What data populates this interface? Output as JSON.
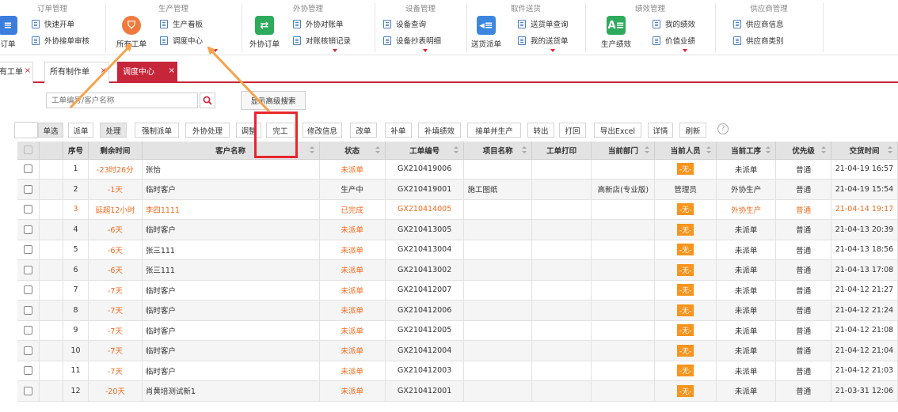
{
  "ribbon": {
    "groups": [
      {
        "title": "订单管理",
        "big_label": "订单",
        "items": [
          "快速开单",
          "外协接单审核"
        ]
      },
      {
        "title": "生产管理",
        "big_label": "所有工单",
        "items": [
          "生产看板",
          "调度中心"
        ]
      },
      {
        "title": "外协管理",
        "big_label": "外协订单",
        "items": [
          "外协对账单",
          "对账核销记录"
        ]
      },
      {
        "title": "设备管理",
        "items": [
          "设备查询",
          "设备抄表明细"
        ]
      },
      {
        "title": "取件送货",
        "big_label": "送货派单",
        "items": [
          "送货单查询",
          "我的送货单"
        ]
      },
      {
        "title": "绩效管理",
        "big_label": "生产绩效",
        "items": [
          "我的绩效",
          "价值业绩"
        ]
      },
      {
        "title": "供应商管理",
        "items": [
          "供应商信息",
          "供应商类别"
        ]
      }
    ]
  },
  "tabs": [
    {
      "label": "有工单"
    },
    {
      "label": "所有制作单"
    },
    {
      "label": "调度中心"
    }
  ],
  "tab_close": "×",
  "search": {
    "placeholder": "工单编号/客户名称",
    "adv_label": "显示高级搜索"
  },
  "toolbar": {
    "toggle_label": "单选",
    "buttons": [
      "派单",
      "处理",
      "强制派单",
      "外协处理",
      "调整",
      "完工",
      "修改信息",
      "改单",
      "补单",
      "补填绩效",
      "接单并生产",
      "转出",
      "打回",
      "导出Excel",
      "详情",
      "刷新"
    ],
    "help": "?"
  },
  "table": {
    "columns": [
      "序号",
      "剩余时间",
      "客户名称",
      "状态",
      "工单编号",
      "项目名称",
      "工单打印",
      "当前部门",
      "当前人员",
      "当前工序",
      "优先级",
      "交货时间"
    ],
    "rows": [
      {
        "no": "1",
        "remain": "-23时26分",
        "customer": "张怡",
        "status": "未派单",
        "code": "GX210419006",
        "project": "",
        "dept": "",
        "person": "-无-",
        "process": "未派单",
        "priority": "普通",
        "delivery": "21-04-19 16:57",
        "highlight": false
      },
      {
        "no": "2",
        "remain": "-1天",
        "customer": "临时客户",
        "status": "生产中",
        "code": "GX210419001",
        "project": "施工图纸",
        "dept": "高新店(专业版)",
        "person": "管理员",
        "process": "外协生产",
        "priority": "普通",
        "delivery": "21-04-19 15:54",
        "highlight": false
      },
      {
        "no": "3",
        "remain": "延超12小时",
        "customer": "李四1111",
        "status": "已完成",
        "code": "GX210414005",
        "project": "",
        "dept": "",
        "person": "-无-",
        "process": "外协生产",
        "priority": "普通",
        "delivery": "21-04-14 19:17",
        "highlight": true
      },
      {
        "no": "4",
        "remain": "-6天",
        "customer": "临时客户",
        "status": "未派单",
        "code": "GX210413005",
        "project": "",
        "dept": "",
        "person": "-无-",
        "process": "未派单",
        "priority": "普通",
        "delivery": "21-04-13 20:39",
        "highlight": false
      },
      {
        "no": "5",
        "remain": "-6天",
        "customer": "张三111",
        "status": "未派单",
        "code": "GX210413004",
        "project": "",
        "dept": "",
        "person": "-无-",
        "process": "未派单",
        "priority": "普通",
        "delivery": "21-04-13 18:56",
        "highlight": false
      },
      {
        "no": "6",
        "remain": "-6天",
        "customer": "张三111",
        "status": "未派单",
        "code": "GX210413002",
        "project": "",
        "dept": "",
        "person": "-无-",
        "process": "未派单",
        "priority": "普通",
        "delivery": "21-04-13 17:08",
        "highlight": false
      },
      {
        "no": "7",
        "remain": "-7天",
        "customer": "临时客户",
        "status": "未派单",
        "code": "GX210412007",
        "project": "",
        "dept": "",
        "person": "-无-",
        "process": "未派单",
        "priority": "普通",
        "delivery": "21-04-12 21:27",
        "highlight": false
      },
      {
        "no": "8",
        "remain": "-7天",
        "customer": "临时客户",
        "status": "未派单",
        "code": "GX210412006",
        "project": "",
        "dept": "",
        "person": "-无-",
        "process": "未派单",
        "priority": "普通",
        "delivery": "21-04-12 21:24",
        "highlight": false
      },
      {
        "no": "9",
        "remain": "-7天",
        "customer": "临时客户",
        "status": "未派单",
        "code": "GX210412005",
        "project": "",
        "dept": "",
        "person": "-无-",
        "process": "未派单",
        "priority": "普通",
        "delivery": "21-04-12 21:08",
        "highlight": false
      },
      {
        "no": "10",
        "remain": "-7天",
        "customer": "临时客户",
        "status": "未派单",
        "code": "GX210412004",
        "project": "",
        "dept": "",
        "person": "-无-",
        "process": "未派单",
        "priority": "普通",
        "delivery": "21-04-12 21:04",
        "highlight": false
      },
      {
        "no": "11",
        "remain": "-7天",
        "customer": "临时客户",
        "status": "未派单",
        "code": "GX210412003",
        "project": "",
        "dept": "",
        "person": "-无-",
        "process": "未派单",
        "priority": "普通",
        "delivery": "21-04-12 21:03",
        "highlight": false
      },
      {
        "no": "12",
        "remain": "-20天",
        "customer": "肖黄培测试新1",
        "status": "未派单",
        "code": "GX210412001",
        "project": "",
        "dept": "",
        "person": "-无-",
        "process": "未派单",
        "priority": "普通",
        "delivery": "21-03-31 12:06",
        "highlight": false
      }
    ]
  },
  "colors": {
    "brand_red": "#c7263a",
    "orange": "#f06a1d",
    "badge": "#f7941d",
    "annotation": "#f7a24a",
    "highlight_box": "#e8262d"
  }
}
